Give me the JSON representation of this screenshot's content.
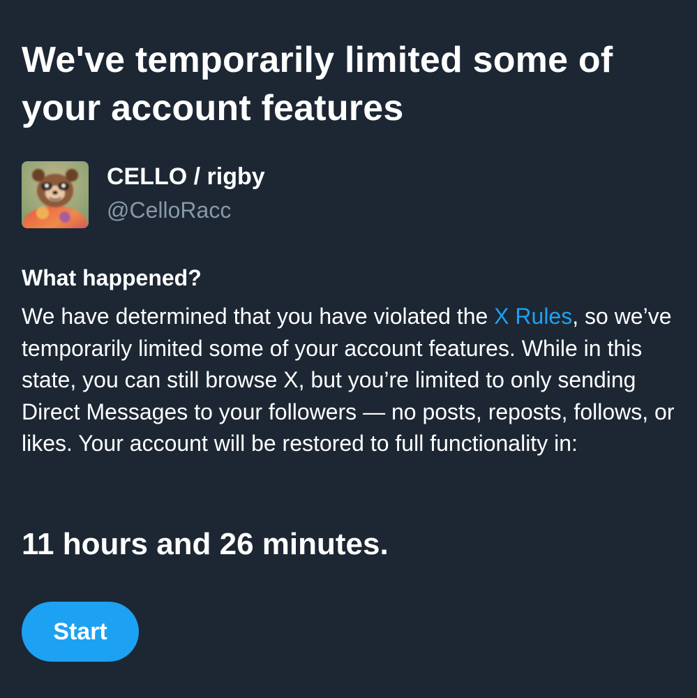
{
  "title": "We've temporarily limited some of your account features",
  "account": {
    "display_name": "CELLO / rigby",
    "handle": "@CelloRacc"
  },
  "what_happened": {
    "heading": "What happened?",
    "text_before_link": "We have determined that you have violated the ",
    "link_label": "X Rules",
    "text_after_link": ", so we’ve temporarily limited some of your account features. While in this state, you can still browse X, but you’re limited to only sending Direct Messages to your followers — no posts, reposts, follows, or likes. Your account will be restored to full functionality in:"
  },
  "countdown": "11 hours and 26 minutes.",
  "start_button_label": "Start",
  "colors": {
    "background": "#1c2733",
    "accent": "#1da1f2",
    "secondary_text": "#8899a6"
  }
}
